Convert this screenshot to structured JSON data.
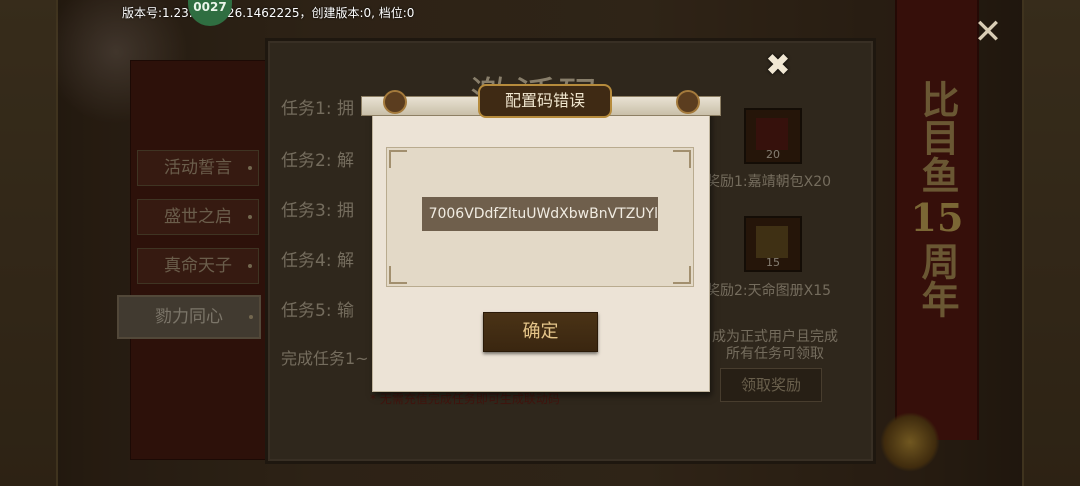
{
  "status_bar": {
    "version_text": "版本号:1.23.0116.26.1462225，创建版本:0, 档位:0",
    "badge": "0027"
  },
  "menu": {
    "items": [
      {
        "label": "活动誓言"
      },
      {
        "label": "盛世之启"
      },
      {
        "label": "真命天子"
      },
      {
        "label": "勠力同心"
      }
    ],
    "active": "勠力同心"
  },
  "tasks": {
    "items": [
      "任务1: 拥",
      "任务2: 解",
      "任务3: 拥",
      "任务4: 解",
      "任务5: 输"
    ],
    "complete_line": "完成任务1~",
    "note": "* 无需充值完成任务即可生成联动码"
  },
  "rewards": {
    "reward1": {
      "label": "奖励1:嘉靖朝包X20",
      "count": "20"
    },
    "reward2": {
      "label": "奖励2:天命图册X15",
      "count": "15"
    },
    "condition_line1": "成为正式用户且完成",
    "condition_line2": "所有任务可领取",
    "claim_label": "领取奖励"
  },
  "banner": {
    "text_top": "比目鱼",
    "number": "15",
    "text_bottom": "周年"
  },
  "dialog": {
    "title": "配置码错误",
    "title_deco": "激活码",
    "code_value": "7006VDdfZltuUWdXbwBnVTZUYl",
    "ok_label": "确定"
  },
  "icons": {
    "dialog_close": "close-icon",
    "panel_close": "close-icon"
  }
}
